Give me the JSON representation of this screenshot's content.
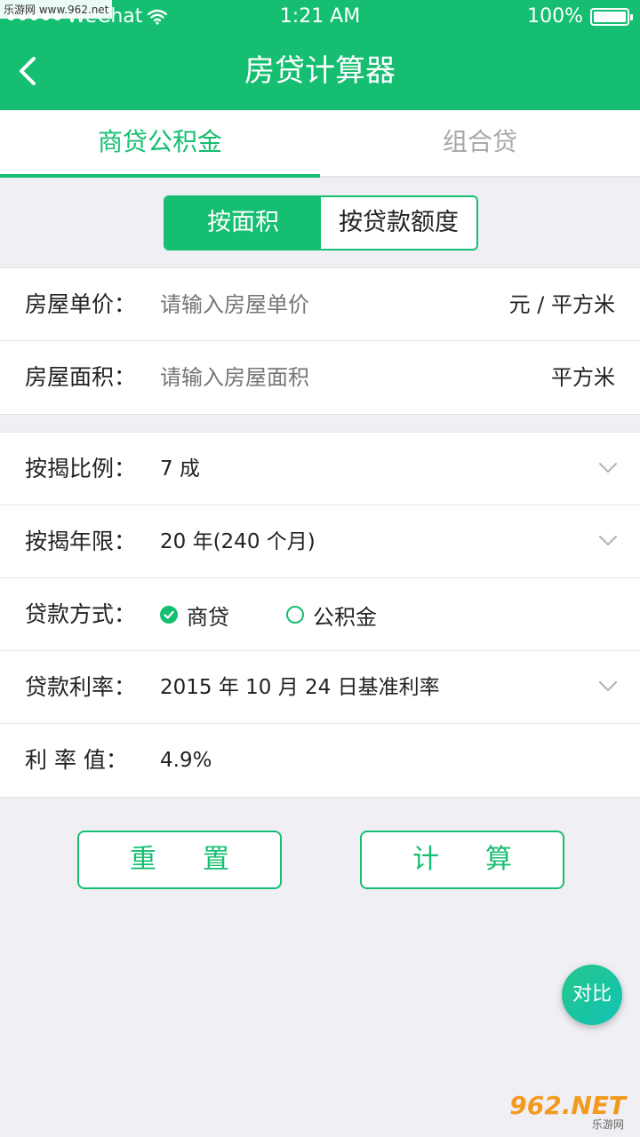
{
  "status_bar": {
    "carrier": "WeChat",
    "time": "1:21 AM",
    "battery": "100%",
    "battery_level": 1.0
  },
  "watermarks": {
    "top_left": "乐游网 www.962.net",
    "bottom_right_logo": "962.NET",
    "bottom_right_sub": "乐游网"
  },
  "nav": {
    "title": "房贷计算器",
    "back_icon": "chevron-left-icon"
  },
  "tabs": [
    {
      "label": "商贷公积金",
      "active": true
    },
    {
      "label": "组合贷",
      "active": false
    }
  ],
  "segment": [
    {
      "label": "按面积",
      "active": true
    },
    {
      "label": "按贷款额度",
      "active": false
    }
  ],
  "area_form": {
    "price": {
      "label": "房屋单价：",
      "placeholder": "请输入房屋单价",
      "unit": "元 / 平方米"
    },
    "area": {
      "label": "房屋面积：",
      "placeholder": "请输入房屋面积",
      "unit": "平方米"
    }
  },
  "loan_form": {
    "ratio": {
      "label": "按揭比例：",
      "value": "7 成"
    },
    "years": {
      "label": "按揭年限：",
      "value": "20 年(240 个月)"
    },
    "method": {
      "label": "贷款方式：",
      "options": [
        {
          "label": "商贷",
          "checked": true
        },
        {
          "label": "公积金",
          "checked": false
        }
      ]
    },
    "rate": {
      "label": "贷款利率：",
      "value": "2015 年 10 月 24 日基准利率"
    },
    "rate_value": {
      "label": "利 率 值：",
      "value": "4.9%"
    }
  },
  "buttons": {
    "reset": "重置",
    "calculate": "计算"
  },
  "fab": {
    "label": "对比"
  },
  "colors": {
    "brand": "#16be71",
    "background": "#efeff4",
    "placeholder": "#b8b8b8"
  }
}
